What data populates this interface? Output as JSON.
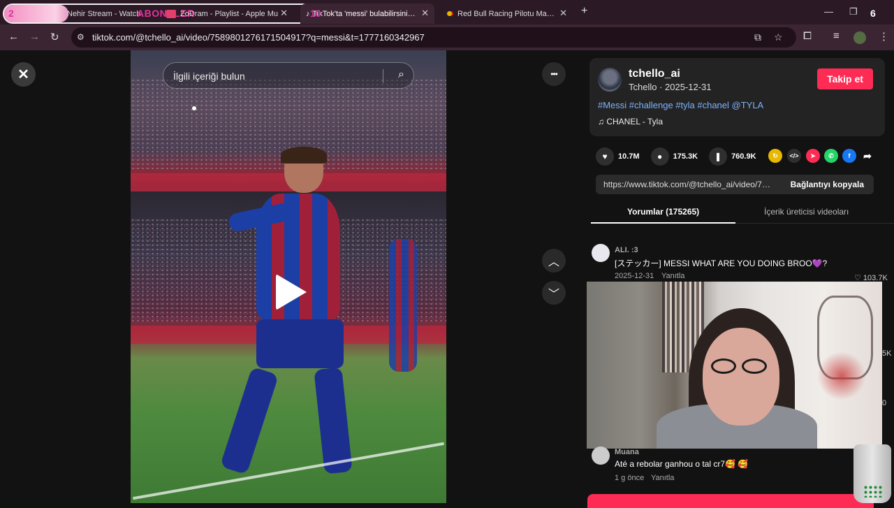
{
  "browser": {
    "tabs": [
      {
        "title": "Nehir Stream - Watch"
      },
      {
        "title": "ZoDram - Playlist - Apple Mu"
      },
      {
        "title": "TikTok'ta 'messi' bulabilirsiniz | T"
      },
      {
        "title": "Red Bull Racing Pilotu Max Ver"
      }
    ],
    "new_tab": "+",
    "url": "tiktok.com/@tchello_ai/video/7589801276171504917?q=messi&t=1777160342967"
  },
  "overlay": {
    "label": "ABONELER",
    "num_left": "2",
    "num_mid": "10",
    "num_right": "6"
  },
  "video": {
    "search_placeholder": "İlgili içeriği bulun",
    "close": "✕",
    "more": "•••"
  },
  "post": {
    "username": "tchello_ai",
    "subline": "Tchello · 2025-12-31",
    "follow_label": "Takip et",
    "tags": "#Messi #challenge #tyla #chanel @TYLA",
    "music": "♫  CHANEL - Tyla",
    "likes": "10.7M",
    "comments": "175.3K",
    "saves": "760.9K",
    "link_url": "https://www.tiktok.com/@tchello_ai/video/75...",
    "copy_label": "Bağlantıyı kopyala",
    "tab_comments": "Yorumlar (175265)",
    "tab_creator": "İçerik üreticisi videoları"
  },
  "comments": [
    {
      "user": "ALI. :3",
      "text": "[ステッカー] MESSI WHAT ARE YOU DOING BROO💜?",
      "date": "2025-12-31",
      "reply": "Yanıtla",
      "likes": "♡ 103.7K"
    },
    {
      "user": "Muana",
      "text": "Até a rebolar ganhou o tal cr7🥰 🥰",
      "date": "1 g önce",
      "reply": "Yanıtla"
    }
  ],
  "side_numbers": {
    "a": "5K",
    "b": "0"
  },
  "colors": {
    "accent": "#fe2c55",
    "tag": "#7cb3ff"
  }
}
